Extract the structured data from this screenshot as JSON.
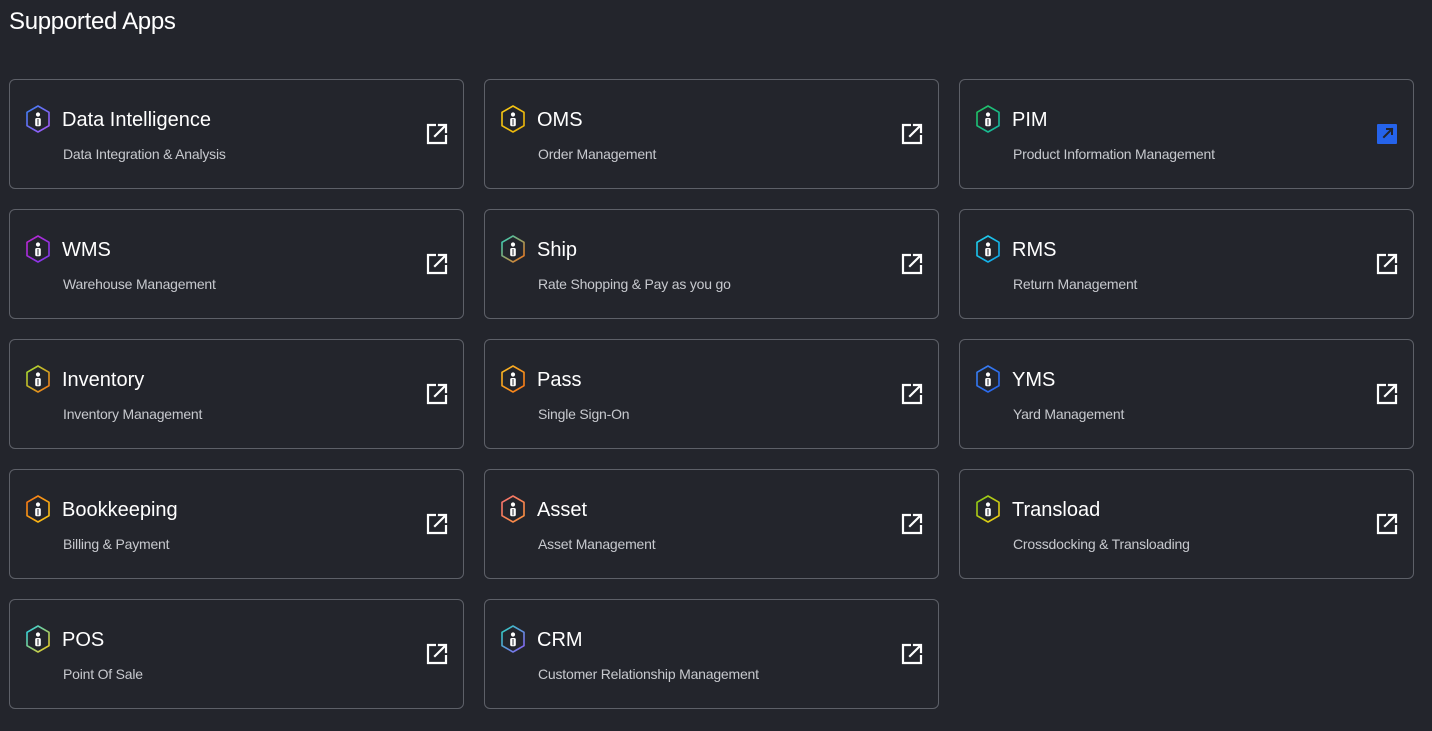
{
  "header": {
    "title": "Supported Apps"
  },
  "apps": [
    {
      "name": "Data Intelligence",
      "desc": "Data Integration & Analysis",
      "icon": "hexagon-logo-icon",
      "colors": [
        "#3b82f6",
        "#a855f7"
      ],
      "link_color": "#ffffff"
    },
    {
      "name": "OMS",
      "desc": "Order Management",
      "icon": "hexagon-logo-icon",
      "colors": [
        "#facc15",
        "#eab308"
      ],
      "link_color": "#ffffff"
    },
    {
      "name": "PIM",
      "desc": "Product Information Management",
      "icon": "hexagon-logo-icon",
      "colors": [
        "#22c55e",
        "#14b8a6"
      ],
      "link_color": "#2563eb",
      "link_active": true
    },
    {
      "name": "WMS",
      "desc": "Warehouse Management",
      "icon": "hexagon-logo-icon",
      "colors": [
        "#c026d3",
        "#7c3aed"
      ],
      "link_color": "#ffffff"
    },
    {
      "name": "Ship",
      "desc": "Rate Shopping & Pay as you go",
      "icon": "hexagon-logo-icon",
      "colors": [
        "#2dd4bf",
        "#f97316"
      ],
      "link_color": "#ffffff"
    },
    {
      "name": "RMS",
      "desc": "Return Management",
      "icon": "hexagon-logo-icon",
      "colors": [
        "#22d3ee",
        "#0ea5e9"
      ],
      "link_color": "#ffffff"
    },
    {
      "name": "Inventory",
      "desc": "Inventory Management",
      "icon": "hexagon-logo-icon",
      "colors": [
        "#a3e635",
        "#f97316"
      ],
      "link_color": "#ffffff"
    },
    {
      "name": "Pass",
      "desc": "Single Sign-On",
      "icon": "hexagon-logo-icon",
      "colors": [
        "#fbbf24",
        "#f97316"
      ],
      "link_color": "#ffffff"
    },
    {
      "name": "YMS",
      "desc": "Yard Management",
      "icon": "hexagon-logo-icon",
      "colors": [
        "#3b82f6",
        "#2563eb"
      ],
      "link_color": "#ffffff"
    },
    {
      "name": "Bookkeeping",
      "desc": "Billing & Payment",
      "icon": "hexagon-logo-icon",
      "colors": [
        "#f97316",
        "#facc15"
      ],
      "link_color": "#ffffff"
    },
    {
      "name": "Asset",
      "desc": "Asset Management",
      "icon": "hexagon-logo-icon",
      "colors": [
        "#f87171",
        "#fb923c"
      ],
      "link_color": "#ffffff"
    },
    {
      "name": "Transload",
      "desc": "Crossdocking & Transloading",
      "icon": "hexagon-logo-icon",
      "colors": [
        "#84cc16",
        "#facc15"
      ],
      "link_color": "#ffffff"
    },
    {
      "name": "POS",
      "desc": "Point Of Sale",
      "icon": "hexagon-logo-icon",
      "colors": [
        "#22d3ee",
        "#facc15"
      ],
      "link_color": "#ffffff"
    },
    {
      "name": "CRM",
      "desc": "Customer Relationship Management",
      "icon": "hexagon-logo-icon",
      "colors": [
        "#2dd4bf",
        "#8b5cf6"
      ],
      "link_color": "#ffffff"
    }
  ],
  "theme": {
    "background": "#23252c",
    "card_border": "#5d6068",
    "text": "#ffffff",
    "subtext": "#c7c9ce"
  }
}
